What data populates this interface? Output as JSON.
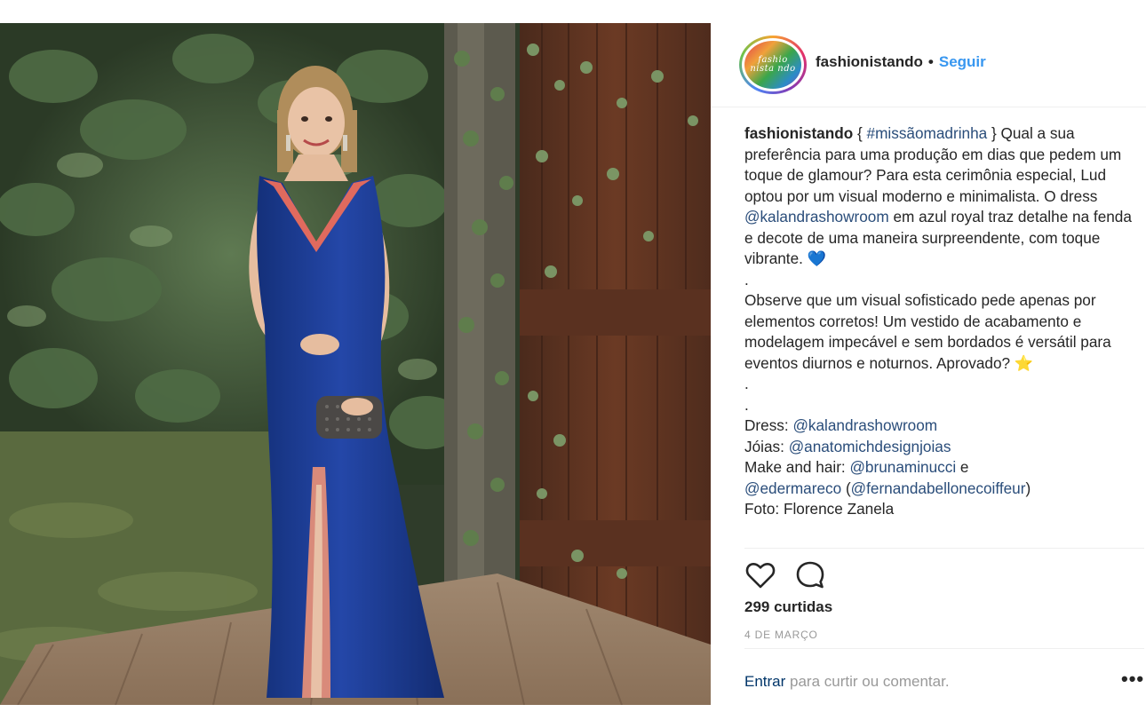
{
  "header": {
    "avatar_text": "fashio nista ndo",
    "username": "fashionistando",
    "separator": "•",
    "follow_label": "Seguir"
  },
  "caption": {
    "username": "fashionistando",
    "brace_open": " { ",
    "hashtag": "#missãomadrinha",
    "text_1": " } Qual a sua preferência para uma produção em dias que pedem um toque de glamour? Para esta cerimônia especial, Lud optou por um visual moderno e minimalista. O dress ",
    "mention_1": "@kalandrashowroom",
    "text_2": " em azul royal traz detalhe na fenda e decote de uma maneira surpreendente, com toque vibrante. ",
    "heart_emoji": "💙",
    "dot_1": ".",
    "text_3": "Observe que um visual sofisticado pede apenas por elementos corretos! Um vestido de acabamento e modelagem impecável e sem bordados é versátil para eventos diurnos e noturnos. Aprovado? ",
    "star_emoji": "⭐",
    "dot_2": ".",
    "dot_3": ".",
    "dress_label": "Dress: ",
    "dress_mention": "@kalandrashowroom",
    "jewels_label": "Jóias: ",
    "jewels_mention": "@anatomichdesignjoias",
    "make_label": "Make and hair: ",
    "make_mention": "@brunaminucci",
    "make_and": " e",
    "make_mention_2": "@edermareco",
    "paren_open": " (",
    "make_mention_3": "@fernandabellonecoiffeur",
    "paren_close": ")",
    "foto_line": "Foto: Florence Zanela"
  },
  "actions": {
    "like_icon": "heart-outline-icon",
    "comment_icon": "speech-bubble-icon"
  },
  "likes": "299 curtidas",
  "date": "4 DE MARÇO",
  "comment_bar": {
    "login_label": "Entrar",
    "prompt": " para curtir ou comentar.",
    "more_label": "•••"
  },
  "colors": {
    "follow": "#3897f0",
    "mention": "#2a4d7a",
    "login": "#003569",
    "dress_blue": "#1d3f98",
    "dress_trim": "#e06a5e"
  }
}
